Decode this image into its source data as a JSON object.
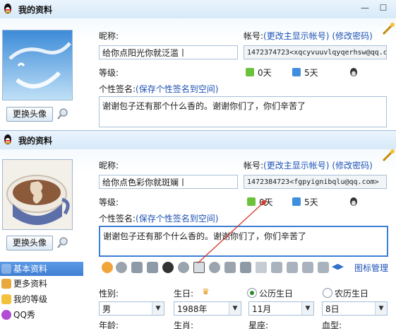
{
  "window_title": "我的资料",
  "top": {
    "change_avatar": "更换头像",
    "nickname_label": "昵称:",
    "nickname_value": "给你点阳光你就泛滥丨",
    "account_label": "帐号:",
    "show_account_link": "(更改主显示帐号)",
    "change_password_link": "(修改密码)",
    "account_value": "1472374723<xqcyvuuvlqyqerhsw@qq.c",
    "level_label": "等级:",
    "level_days": "0天",
    "level_remaining": "5天",
    "signature_label": "个性签名:",
    "save_signature_link": "(保存个性签名到空间)",
    "signature_value": "谢谢包子还有那个什么香的。谢谢你们了，你们辛苦了"
  },
  "bottom": {
    "change_avatar": "更换头像",
    "nickname_label": "昵称:",
    "nickname_value": "给你点色彩你就斑斓丨",
    "account_label": "帐号:",
    "show_account_link": "(更改主显示帐号)",
    "change_password_link": "(修改密码)",
    "account_value": "1472384723<fgpyignibqlu@qq.com>",
    "level_label": "等级:",
    "level_days": "0天",
    "level_remaining": "5天",
    "signature_label": "个性签名:",
    "save_signature_link": "(保存个性签名到空间)",
    "signature_value": "谢谢包子还有那个什么香的。谢谢你们了，你们辛苦了",
    "icon_manage_link": "图标管理"
  },
  "sidebar": {
    "items": [
      {
        "label": "基本资料",
        "active": true
      },
      {
        "label": "更多资料"
      },
      {
        "label": "我的等级"
      },
      {
        "label": "QQ秀"
      }
    ]
  },
  "form": {
    "gender_label": "性别:",
    "gender_value": "男",
    "birthday_label": "生日:",
    "year_value": "1988年",
    "solar_label": "公历生日",
    "month_value": "11月",
    "lunar_label": "农历生日",
    "day_value": "8日",
    "age_label": "年龄:",
    "zodiac_label": "生肖:",
    "constellation_label": "星座:",
    "blood_label": "血型:"
  },
  "colors": {
    "accent": "#3f7fd3",
    "link": "#1d52b5",
    "annotation_arrow": "#d33a2c"
  }
}
